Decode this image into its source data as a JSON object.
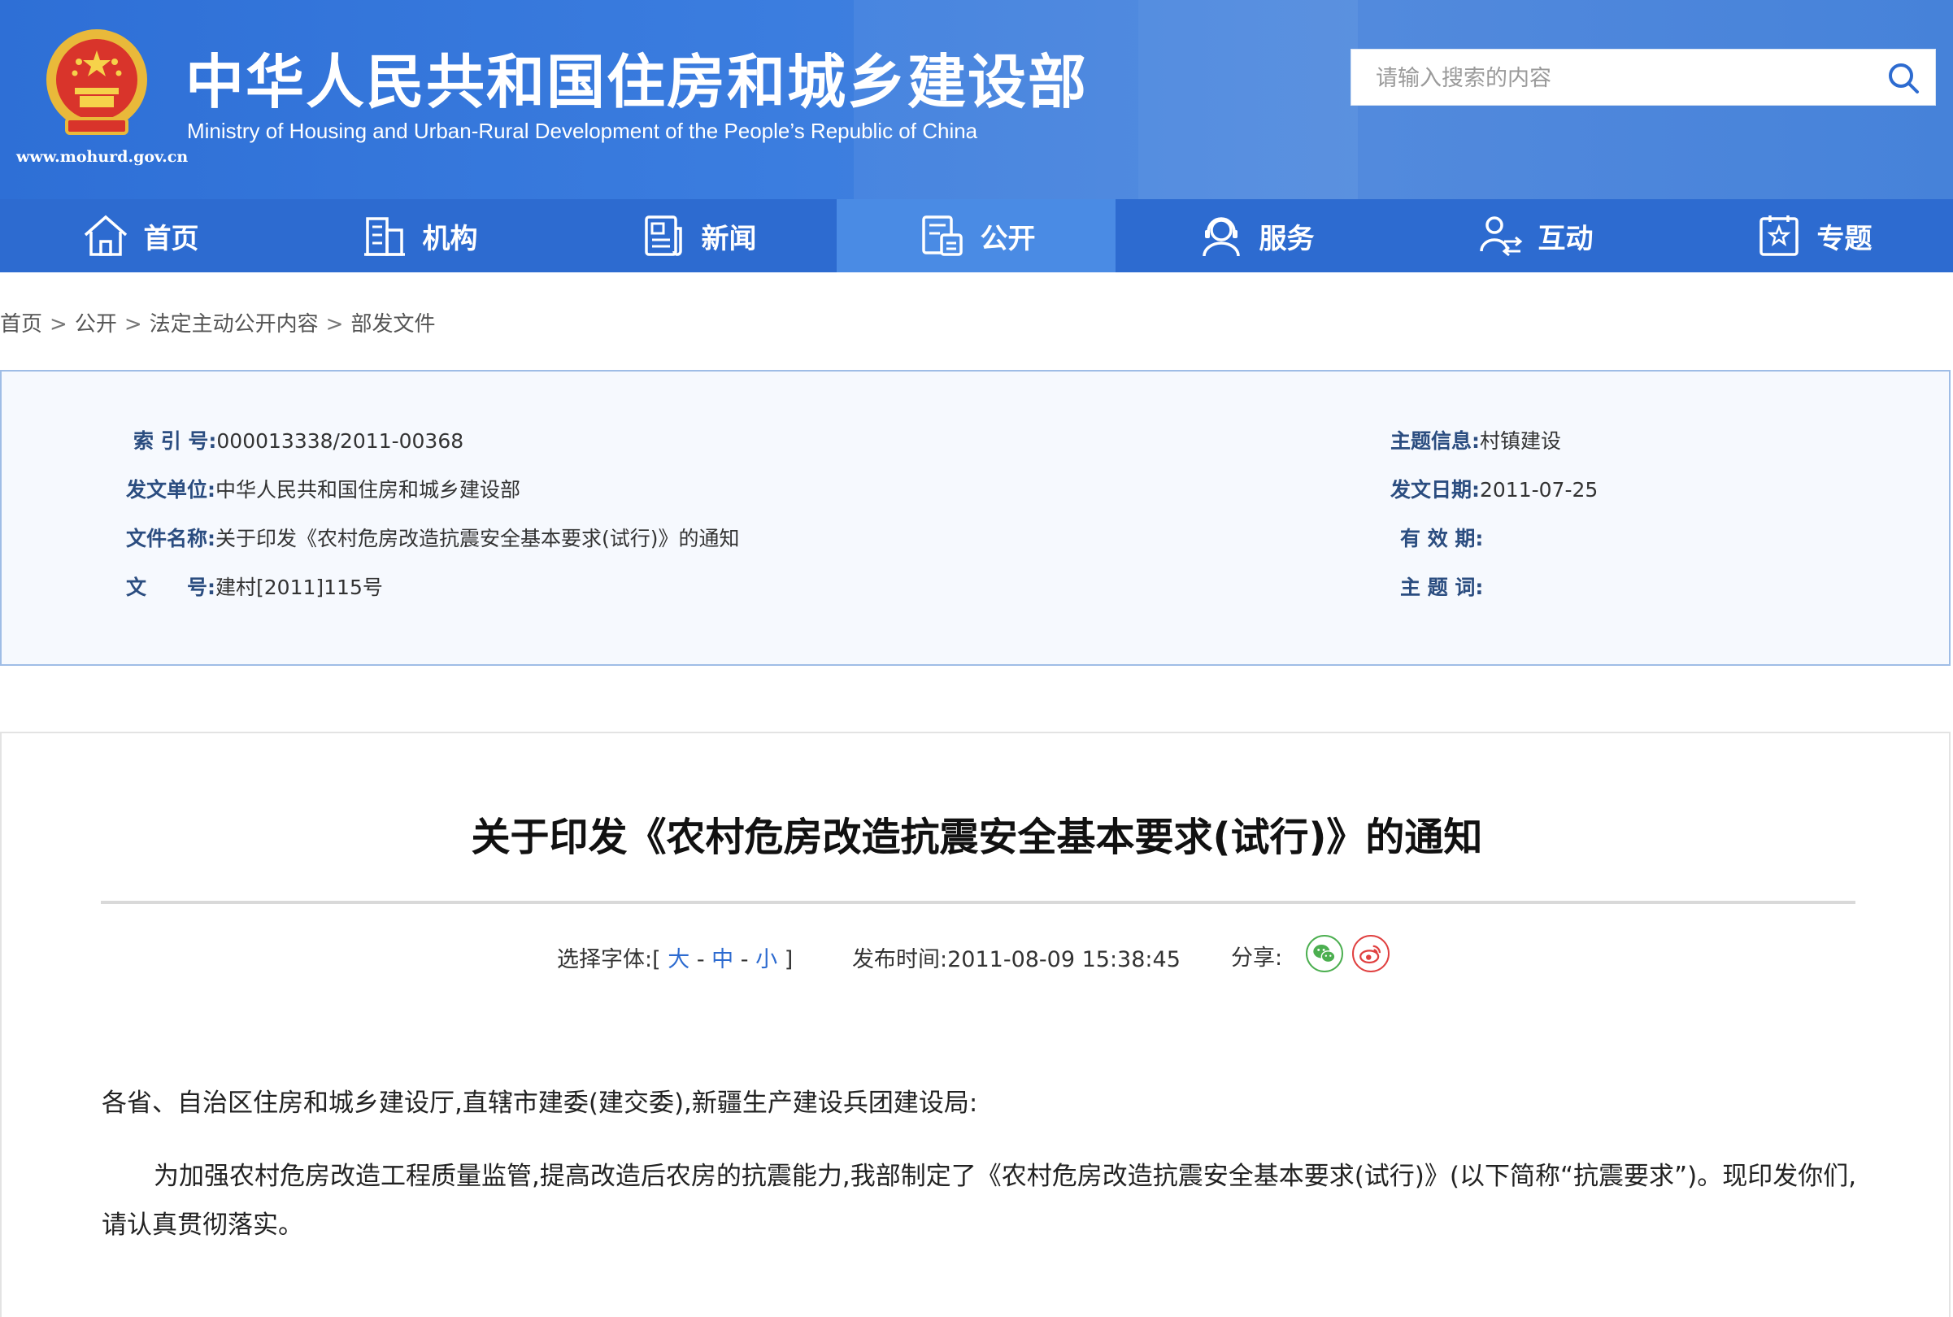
{
  "header": {
    "title": "中华人民共和国住房和城乡建设部",
    "subtitle": "Ministry of Housing and Urban-Rural Development of the People’s Republic of China",
    "url": "www.mohurd.gov.cn",
    "search_placeholder": "请输入搜索的内容",
    "colors": {
      "brand": "#2d6bd0",
      "active_nav": "#4a8be4"
    }
  },
  "nav": {
    "items": [
      {
        "label": "首页",
        "icon": "home-icon"
      },
      {
        "label": "机构",
        "icon": "building-icon"
      },
      {
        "label": "新闻",
        "icon": "newspaper-icon"
      },
      {
        "label": "公开",
        "icon": "document-icon",
        "active": true
      },
      {
        "label": "服务",
        "icon": "customer-service-icon"
      },
      {
        "label": "互动",
        "icon": "interaction-icon"
      },
      {
        "label": "专题",
        "icon": "star-icon"
      }
    ]
  },
  "breadcrumb": {
    "items": [
      "首页",
      "公开",
      "法定主动公开内容",
      "部发文件"
    ],
    "separator": ">"
  },
  "info": {
    "index_no": {
      "label": "索 引 号:",
      "value": "000013338/2011-00368"
    },
    "issuer": {
      "label": "发文单位:",
      "value": "中华人民共和国住房和城乡建设部"
    },
    "file_name": {
      "label": "文件名称:",
      "value": "关于印发《农村危房改造抗震安全基本要求(试行)》的通知"
    },
    "doc_no": {
      "label": "文　　号:",
      "value": "建村[2011]115号"
    },
    "topic": {
      "label": "主题信息:",
      "value": "村镇建设"
    },
    "issue_date": {
      "label": "发文日期:",
      "value": "2011-07-25"
    },
    "validity": {
      "label": "有 效 期:",
      "value": ""
    },
    "keywords": {
      "label": "主 题 词:",
      "value": ""
    }
  },
  "article": {
    "title": "关于印发《农村危房改造抗震安全基本要求(试行)》的通知",
    "font_label": "选择字体:[",
    "font_large": "大",
    "font_medium": "中",
    "font_small": "小",
    "font_dash": "-",
    "font_close": "]",
    "publish_label": "发布时间:",
    "publish_time": "2011-08-09 15:38:45",
    "share_label": "分享:",
    "share_icons": [
      "wechat-icon",
      "weibo-icon"
    ],
    "paragraphs": [
      "各省、自治区住房和城乡建设厅,直辖市建委(建交委),新疆生产建设兵团建设局:",
      "为加强农村危房改造工程质量监管,提高改造后农房的抗震能力,我部制定了《农村危房改造抗震安全基本要求(试行)》(以下简称“抗震要求”)。现印发你们,请认真贯彻落实。"
    ]
  }
}
